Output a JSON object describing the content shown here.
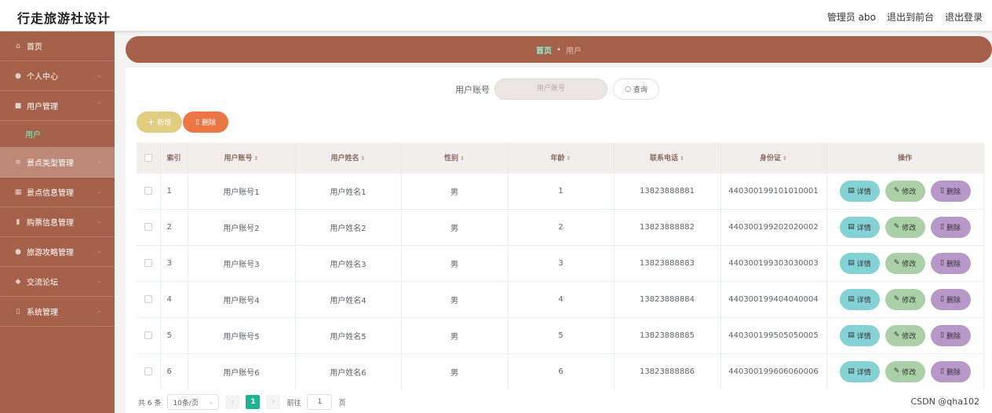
{
  "app": {
    "title": "行走旅游社设计"
  },
  "topbar": {
    "admin_label": "管理员 abo",
    "to_front": "退出到前台",
    "logout": "退出登录"
  },
  "sidebar": {
    "items": [
      {
        "label": "首页",
        "icon": "home-icon",
        "glyph": "⌂"
      },
      {
        "label": "个人中心",
        "icon": "person-icon",
        "glyph": "●"
      },
      {
        "label": "用户管理",
        "icon": "users-icon",
        "glyph": "■"
      },
      {
        "label": "景点类型管理",
        "icon": "menu-icon",
        "glyph": "≡"
      },
      {
        "label": "景点信息管理",
        "icon": "grid-icon",
        "glyph": "▦"
      },
      {
        "label": "购票信息管理",
        "icon": "chart-icon",
        "glyph": "▮"
      },
      {
        "label": "旅游攻略管理",
        "icon": "person-icon",
        "glyph": "●"
      },
      {
        "label": "交流论坛",
        "icon": "chat-icon",
        "glyph": "◆"
      },
      {
        "label": "系统管理",
        "icon": "settings-icon",
        "glyph": "▯"
      }
    ],
    "sub_user": "用户"
  },
  "breadcrumb": {
    "home": "首页",
    "separator": "•",
    "current": "用户"
  },
  "search": {
    "label": "用户账号",
    "placeholder": "用户账号",
    "button": "查询"
  },
  "actions": {
    "add": "新增",
    "delete": "删除"
  },
  "table": {
    "headers": {
      "index": "索引",
      "account": "用户账号",
      "name": "用户姓名",
      "gender": "性别",
      "age": "年龄",
      "phone": "联系电话",
      "id_card": "身份证",
      "ops": "操作"
    },
    "rows": [
      {
        "index": "1",
        "account": "用户账号1",
        "name": "用户姓名1",
        "gender": "男",
        "age": "1",
        "phone": "13823888881",
        "id_card": "440300199101010001"
      },
      {
        "index": "2",
        "account": "用户账号2",
        "name": "用户姓名2",
        "gender": "男",
        "age": "2",
        "phone": "13823888882",
        "id_card": "440300199202020002"
      },
      {
        "index": "3",
        "account": "用户账号3",
        "name": "用户姓名3",
        "gender": "男",
        "age": "3",
        "phone": "13823888883",
        "id_card": "440300199303030003"
      },
      {
        "index": "4",
        "account": "用户账号4",
        "name": "用户姓名4",
        "gender": "男",
        "age": "4",
        "phone": "13823888884",
        "id_card": "440300199404040004"
      },
      {
        "index": "5",
        "account": "用户账号5",
        "name": "用户姓名5",
        "gender": "男",
        "age": "5",
        "phone": "13823888885",
        "id_card": "440300199505050005"
      },
      {
        "index": "6",
        "account": "用户账号6",
        "name": "用户姓名6",
        "gender": "男",
        "age": "6",
        "phone": "13823888886",
        "id_card": "440300199606060006"
      }
    ],
    "ops": {
      "detail": "详情",
      "edit": "修改",
      "delete": "删除"
    }
  },
  "pagination": {
    "total": "共 6 条",
    "page_size": "10条/页",
    "current_page": "1",
    "goto_label": "前往",
    "goto_value": "1",
    "page_suffix": "页"
  },
  "watermark": "CSDN @qha102",
  "colors": {
    "sidebar": "#a6614a",
    "accent": "#21b291",
    "add": "#e1cd80",
    "delete": "#ec7544",
    "detail": "#84d1d6",
    "edit": "#abd0a8",
    "row_delete": "#b798c8"
  }
}
